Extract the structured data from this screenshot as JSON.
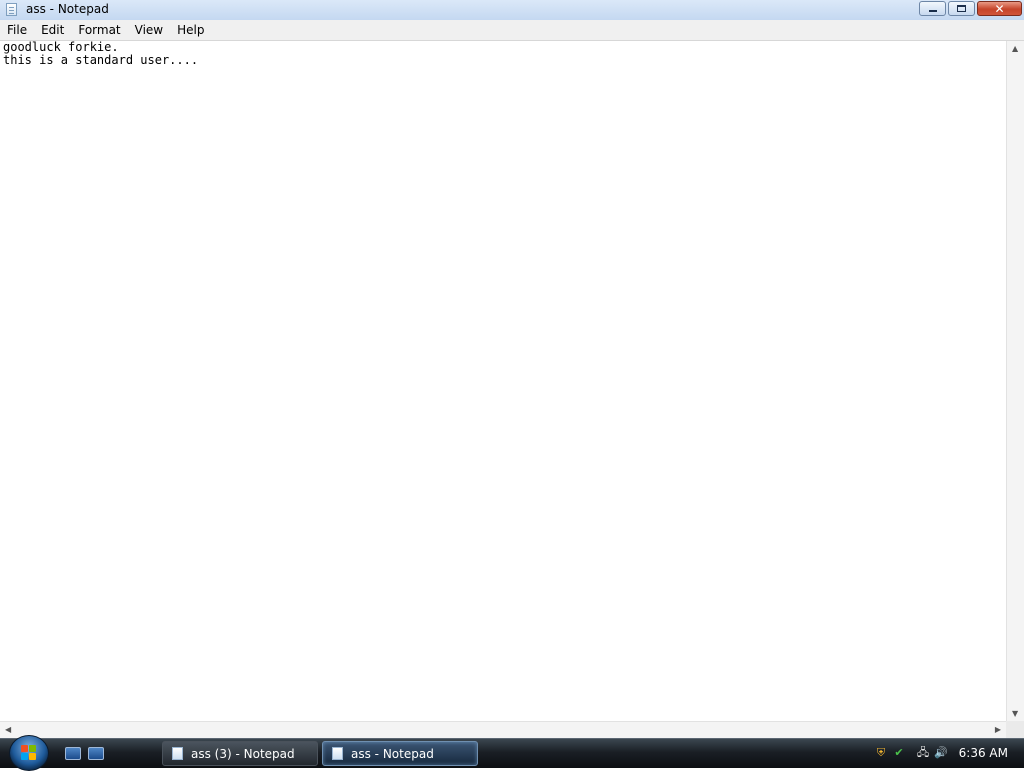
{
  "window": {
    "title": "ass - Notepad",
    "close_glyph": "✕"
  },
  "menu": [
    "File",
    "Edit",
    "Format",
    "View",
    "Help"
  ],
  "editor": {
    "lines": [
      "goodluck forkie.",
      "this is a standard user...."
    ]
  },
  "taskbar": {
    "tasks": [
      {
        "label": "ass (3) - Notepad",
        "active": false
      },
      {
        "label": "ass - Notepad",
        "active": true
      }
    ],
    "clock": "6:36 AM"
  },
  "icons": {
    "title": "notepad-icon",
    "start": "windows-logo-icon",
    "quick_launch": [
      "show-desktop-icon",
      "switch-windows-icon"
    ],
    "tray": [
      "security-shield-icon",
      "network-check-icon",
      "network-icon",
      "volume-icon"
    ]
  },
  "colors": {
    "titlebar": "#c4d8f1",
    "close_button": "#c6452b",
    "taskbar": "#1a1f25",
    "active_task": "#3c5674"
  }
}
